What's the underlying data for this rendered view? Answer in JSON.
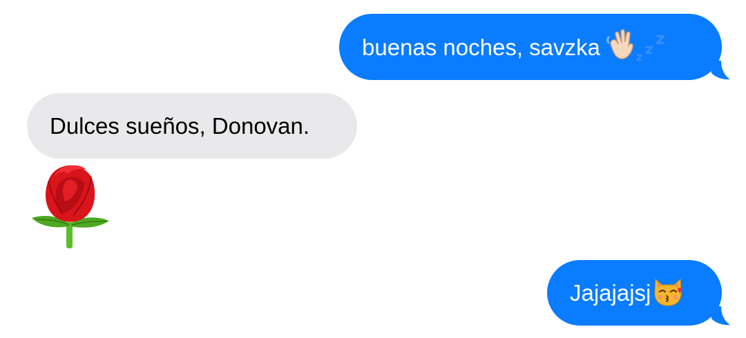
{
  "messages": [
    {
      "id": "msg1",
      "sender": "me",
      "text": "buenas noches, savzka",
      "emojis": [
        "waving-hand-icon",
        "zzz-icon"
      ]
    },
    {
      "id": "msg2",
      "sender": "them",
      "text": "Dulces sueños, Donovan."
    },
    {
      "id": "msg3",
      "sender": "them",
      "type": "sticker",
      "emoji": "rose-icon"
    },
    {
      "id": "msg4",
      "sender": "me",
      "text": "Jajajajsj",
      "emojis": [
        "kissing-cat-icon"
      ]
    }
  ],
  "colors": {
    "outgoing_bubble": "#0a7cff",
    "incoming_bubble": "#e9e9eb",
    "outgoing_text": "#ffffff",
    "incoming_text": "#000000"
  }
}
